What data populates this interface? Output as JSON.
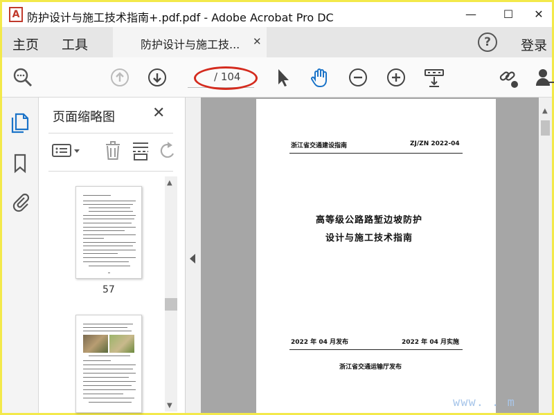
{
  "window": {
    "title": "防护设计与施工技术指南+.pdf.pdf - Adobe Acrobat Pro DC",
    "app_icon_glyph": "A",
    "controls": [
      "—",
      "☐",
      "✕"
    ]
  },
  "menubar": {
    "home": "主页",
    "tools": "工具",
    "tab_label": "防护设计与施工技...",
    "tab_close": "✕",
    "help": "?",
    "login": "登录"
  },
  "toolbar": {
    "page_current": "",
    "page_total": "/ 104",
    "icons": [
      "search-icon",
      "page-up-icon",
      "page-down-icon",
      "select-arrow-icon",
      "hand-icon",
      "zoom-out-icon",
      "zoom-in-icon",
      "fit-width-icon",
      "share-link-icon",
      "add-user-icon"
    ],
    "annotation_color": "#d42b1e"
  },
  "rail": {
    "icons": [
      "page-thumbnails-icon",
      "bookmark-icon",
      "paperclip-icon"
    ],
    "accent": "#1a73c8"
  },
  "thumbnails": {
    "title": "页面缩略图",
    "close": "✕",
    "pages": [
      {
        "number": "57"
      },
      {
        "number": ""
      }
    ]
  },
  "document": {
    "header_left": "浙江省交通建设指南",
    "header_right": "ZJ/ZN 2022-04",
    "title_line1": "高等级公路路堑边坡防护",
    "title_line2": "设计与施工技术指南",
    "date_issue": "2022 年 04 月发布",
    "date_effective": "2022 年 04 月实施",
    "publisher": "浙江省交通运输厅发布"
  },
  "watermark": "www.  . m"
}
